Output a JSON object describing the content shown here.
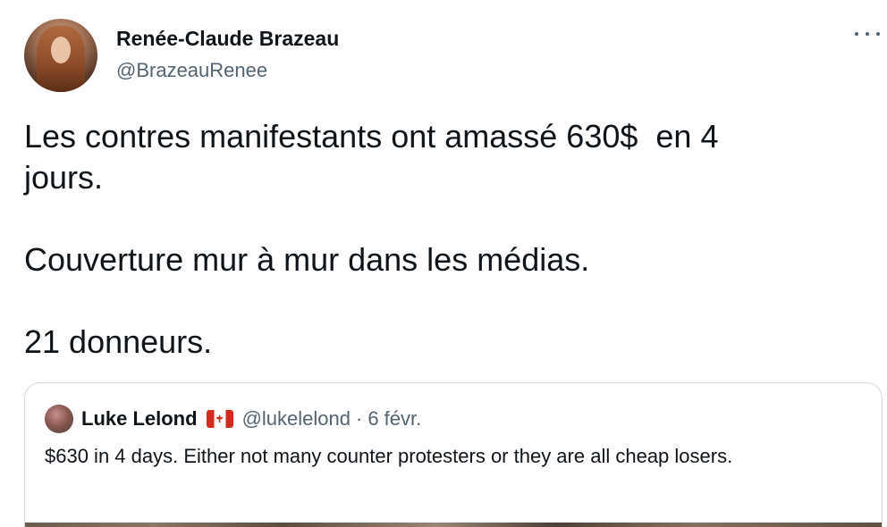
{
  "tweet": {
    "display_name": "Renée-Claude Brazeau",
    "handle": "@BrazeauRenee",
    "more_icon": "more-horizontal-icon",
    "body_lines": [
      "Les contres manifestants ont amassé 630$  en 4",
      "jours.",
      "",
      "Couverture mur à mur dans les médias.",
      "",
      "21 donneurs."
    ]
  },
  "quote": {
    "display_name": "Luke Lelond",
    "flag_icon": "canada-flag-icon",
    "handle": "@lukelelond",
    "separator": "·",
    "date": "6 févr.",
    "text": "$630 in 4 days. Either not many counter protesters or they are all cheap losers."
  },
  "colors": {
    "text_primary": "#0f1419",
    "text_secondary": "#536471",
    "border": "#cfd9de"
  }
}
